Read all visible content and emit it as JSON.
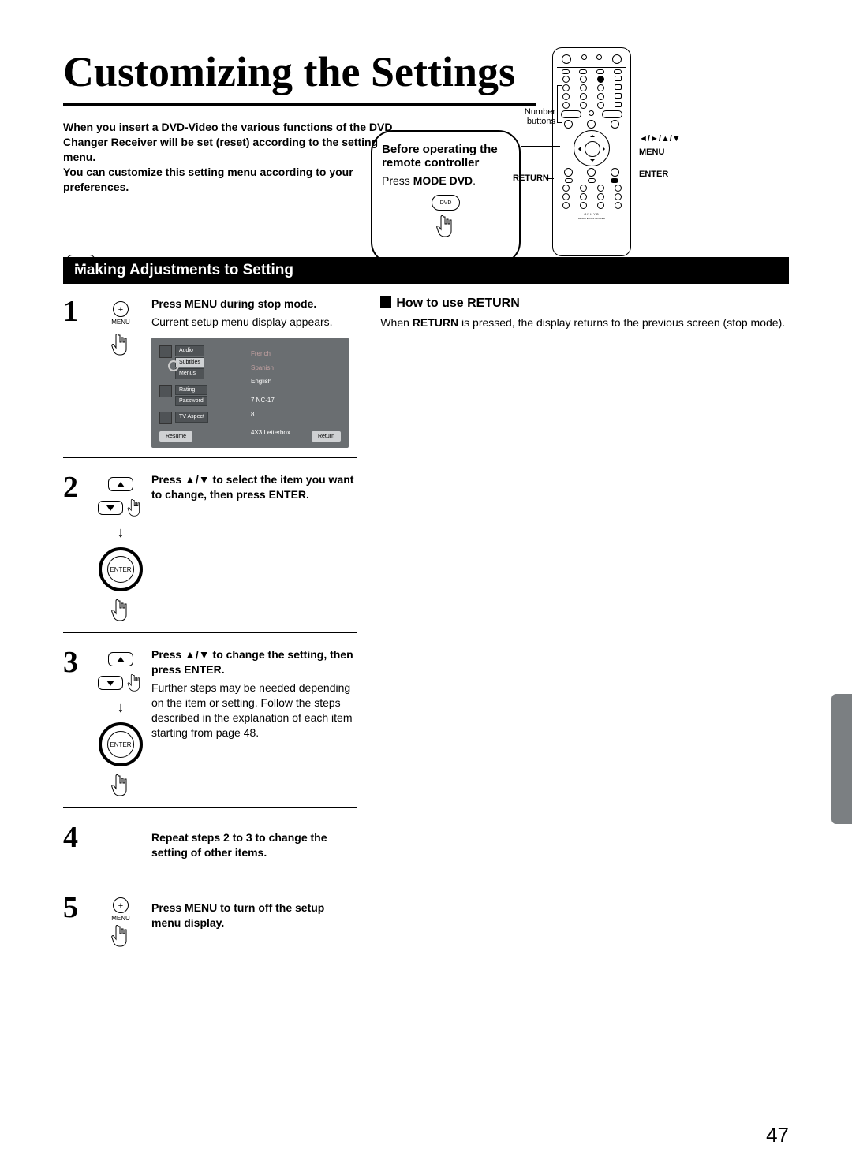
{
  "page": {
    "number": "47",
    "title": "Customizing the Settings",
    "intro_html": [
      "When you insert a DVD-Video the various functions of the DVD Changer Receiver will be set (reset) according to the setting menu.",
      "You can customize this setting menu according to your preferences."
    ],
    "callout": {
      "line1": "Before operating the remote controller",
      "line2": "Press ",
      "line2b": "MODE DVD",
      "dvdbtn": "DVD"
    },
    "dvd_bubble": "DVD",
    "section_bar": "Making Adjustments to Setting",
    "remote_labels": {
      "number_buttons": "Number buttons",
      "arrows": "◄/►/▲/▼",
      "menu": "MENU",
      "enter": "ENTER",
      "return": "RETURN",
      "brand": "ONKYO",
      "sub": "REMOTE CONTROLLER"
    },
    "steps": [
      {
        "n": "1",
        "bold": "Press MENU during stop mode.",
        "sub": "Current setup menu display appears.",
        "icon": "menu"
      },
      {
        "n": "2",
        "bold": "Press ▲/▼ to select the item you want to change, then press ENTER.",
        "icon": "updn-enter"
      },
      {
        "n": "3",
        "bold": "Press ▲/▼ to change the setting, then press ENTER.",
        "sub": "Further steps may be needed depending on the item or setting. Follow the steps described in the explanation of each item starting from page 48.",
        "icon": "updn-enter"
      },
      {
        "n": "4",
        "bold": "Repeat steps 2 to 3 to change the setting of other items."
      },
      {
        "n": "5",
        "bold": "Press MENU to turn off the setup menu display.",
        "icon": "menu-small"
      }
    ],
    "osd": {
      "groups": [
        {
          "items": [
            "Audio",
            "Subtitles",
            "Menus"
          ],
          "sel": 1,
          "right": [
            "French",
            "Spanish",
            "English"
          ]
        },
        {
          "items": [
            "Rating",
            "Password"
          ],
          "right": [
            "7 NC-17",
            "8"
          ]
        },
        {
          "items": [
            "TV Aspect"
          ],
          "right": [
            "4X3 Letterbox"
          ]
        }
      ],
      "btm_left": "Resume",
      "btm_right": "Return"
    },
    "return": {
      "heading": "How to use RETURN",
      "body_pre": "When ",
      "body_bold": "RETURN",
      "body_post": " is pressed, the display returns to the previous screen (stop mode)."
    },
    "icon_labels": {
      "menu": "MENU",
      "enter": "ENTER",
      "plus": "+"
    }
  }
}
